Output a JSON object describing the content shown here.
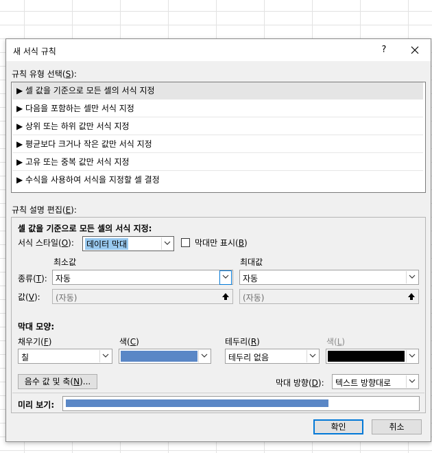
{
  "dialog": {
    "title": "새 서식 규칙",
    "help": "?",
    "rule_type_label": "규칙 유형 선택(",
    "rule_type_key": "S",
    "rule_types": [
      "▶ 셀 값을 기준으로 모든 셀의 서식 지정",
      "▶ 다음을 포함하는 셀만 서식 지정",
      "▶ 상위 또는 하위 값만 서식 지정",
      "▶ 평균보다 크거나 작은 값만 서식 지정",
      "▶ 고유 또는 중복 값만 서식 지정",
      "▶ 수식을 사용하여 서식을 지정할 셀 결정"
    ],
    "edit_label": "규칙 설명 편집(",
    "edit_key": "E",
    "section_heading": "셀 값을 기준으로 모든 셀의 서식 지정:",
    "format_style_label": "서식 스타일(",
    "format_style_key": "O",
    "format_style_value": "데이터 막대",
    "bar_only_label": "막대만 표시(",
    "bar_only_key": "B",
    "min_label": "최소값",
    "max_label": "최대값",
    "type_label": "종류(",
    "type_key": "T",
    "min_type": "자동",
    "max_type": "자동",
    "value_label": "값(",
    "value_key": "V",
    "min_value_placeholder": "(자동)",
    "max_value_placeholder": "(자동)",
    "bar_appearance_heading": "막대 모양:",
    "fill_label": "채우기(",
    "fill_key": "F",
    "fill_value": "칠",
    "color_label": "색(",
    "color_key": "C",
    "fill_color": "#5a87c6",
    "border_label": "테두리(",
    "border_key": "R",
    "border_value": "테두리 없음",
    "border_color_label": "색(",
    "border_color_key": "L",
    "border_color": "#000000",
    "negative_button_pre": "음수 값 및 축(",
    "negative_button_key": "N",
    "negative_button_post": ")...",
    "bar_direction_label": "막대 방향(",
    "bar_direction_key": "D",
    "bar_direction_value": "텍스트 방향대로",
    "preview_label": "미리 보기:",
    "preview_fill_fraction": 0.75,
    "preview_color": "#5a87c6",
    "ok_label": "확인",
    "cancel_label": "취소"
  }
}
